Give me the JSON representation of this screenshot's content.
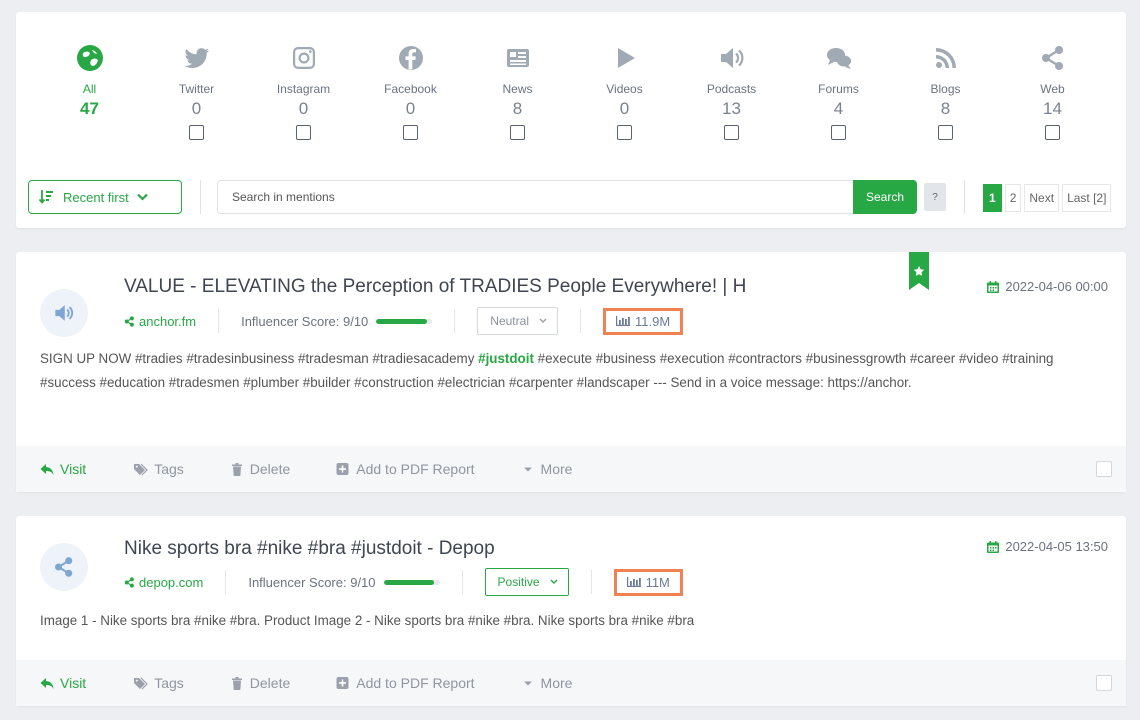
{
  "sources": [
    {
      "label": "All",
      "count": "47",
      "icon": "all-sources-icon"
    },
    {
      "label": "Twitter",
      "count": "0",
      "icon": "twitter-icon"
    },
    {
      "label": "Instagram",
      "count": "0",
      "icon": "instagram-icon"
    },
    {
      "label": "Facebook",
      "count": "0",
      "icon": "facebook-icon"
    },
    {
      "label": "News",
      "count": "8",
      "icon": "news-icon"
    },
    {
      "label": "Videos",
      "count": "0",
      "icon": "play-icon"
    },
    {
      "label": "Podcasts",
      "count": "13",
      "icon": "speaker-icon"
    },
    {
      "label": "Forums",
      "count": "4",
      "icon": "chat-bubbles-icon"
    },
    {
      "label": "Blogs",
      "count": "8",
      "icon": "rss-icon"
    },
    {
      "label": "Web",
      "count": "14",
      "icon": "share-icon"
    }
  ],
  "toolbar": {
    "sort_label": "Recent first",
    "search_placeholder": "Search in mentions",
    "search_button": "Search",
    "help_label": "?",
    "pages": [
      "1",
      "2",
      "Next",
      "Last [2]"
    ]
  },
  "colors": {
    "accent": "#28a745",
    "highlight_box": "#ef8153",
    "reach_text": "#6b7a98"
  },
  "mentions": [
    {
      "title": "VALUE - ELEVATING the Perception of TRADIES People Everywhere! | H",
      "icon": "speaker-icon",
      "domain": "anchor.fm",
      "influencer": "Influencer Score: 9/10",
      "influencer_value": 0.9,
      "sentiment": "Neutral",
      "reach": "11.9M",
      "date": "2022-04-06 00:00",
      "bookmarked": true,
      "text_before": "SIGN UP NOW #tradies #tradesinbusiness #tradesman #tradiesacademy ",
      "text_highlight": "#justdoit",
      "text_after": " #execute #business #execution #contractors #businessgrowth #career #video #training #success #education #tradesmen #plumber #builder #construction #electrician #carpenter #landscaper --- Send in a voice message: https://anchor.",
      "actions": [
        "Visit",
        "Tags",
        "Delete",
        "Add to PDF Report",
        "More"
      ]
    },
    {
      "title": "Nike sports bra #nike #bra #justdoit - Depop",
      "icon": "share-icon",
      "domain": "depop.com",
      "influencer": "Influencer Score: 9/10",
      "influencer_value": 0.9,
      "sentiment": "Positive",
      "reach": "11M",
      "date": "2022-04-05 13:50",
      "bookmarked": false,
      "text_before": "Image 1 - Nike sports bra #nike #bra. Product Image 2 - Nike sports bra #nike #bra. Nike sports bra #nike #bra",
      "text_highlight": "",
      "text_after": "",
      "actions": [
        "Visit",
        "Tags",
        "Delete",
        "Add to PDF Report",
        "More"
      ]
    }
  ]
}
